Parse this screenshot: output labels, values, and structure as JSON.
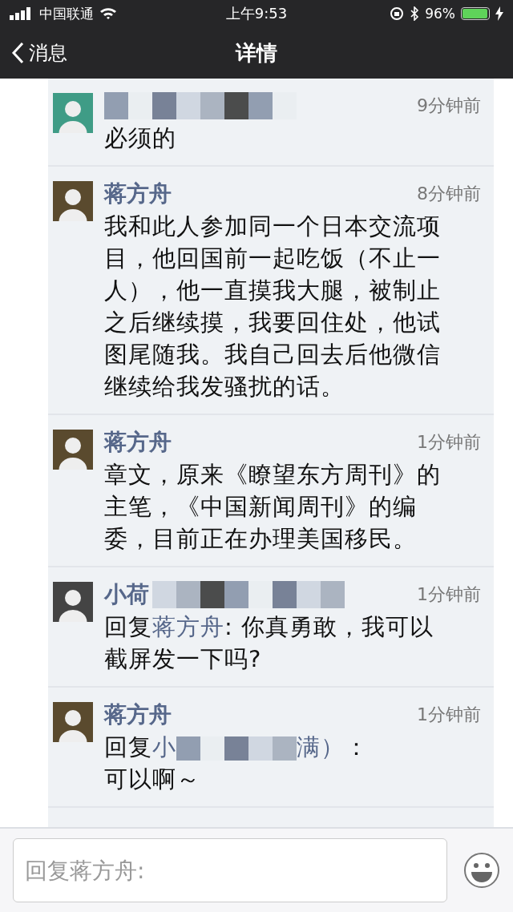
{
  "status_bar": {
    "carrier": "中国联通",
    "time": "上午9:53",
    "battery": "96%"
  },
  "nav": {
    "back": "消息",
    "title": "详情"
  },
  "comments": [
    {
      "name_redacted": true,
      "time": "9分钟前",
      "body": [
        {
          "kind": "text",
          "text": "必须的"
        }
      ]
    },
    {
      "name": "蒋方舟",
      "name_redacted": false,
      "time": "8分钟前",
      "body": [
        {
          "kind": "text",
          "text": "我和此人参加同一个日本交流项目，他回国前一起吃饭（不止一人），他一直摸我大腿，被制止之后继续摸，我要回住处，他试图尾随我。我自己回去后他微信继续给我发骚扰的话。"
        }
      ]
    },
    {
      "name": "蒋方舟",
      "name_redacted": false,
      "time": "1分钟前",
      "body": [
        {
          "kind": "text",
          "text": "章文，原来《瞭望东方周刊》的主笔，《中国新闻周刊》的编委，目前正在办理美国移民。"
        }
      ]
    },
    {
      "name": "小荷",
      "name_redacted": true,
      "time": "1分钟前",
      "body": [
        {
          "kind": "text",
          "text": "回复"
        },
        {
          "kind": "name",
          "text": "蒋方舟"
        },
        {
          "kind": "text",
          "text": ": 你真勇敢，我可以截屏发一下吗?"
        }
      ]
    },
    {
      "name": "蒋方舟",
      "name_redacted": false,
      "time": "1分钟前",
      "body": [
        {
          "kind": "text",
          "text": "回复"
        },
        {
          "kind": "name",
          "text": "小"
        },
        {
          "kind": "mosaic"
        },
        {
          "kind": "name",
          "text": "满）"
        },
        {
          "kind": "text",
          "text": "："
        },
        {
          "kind": "line",
          "text": "可以啊～"
        }
      ]
    }
  ],
  "reply_box": {
    "placeholder": "回复蒋方舟:"
  }
}
